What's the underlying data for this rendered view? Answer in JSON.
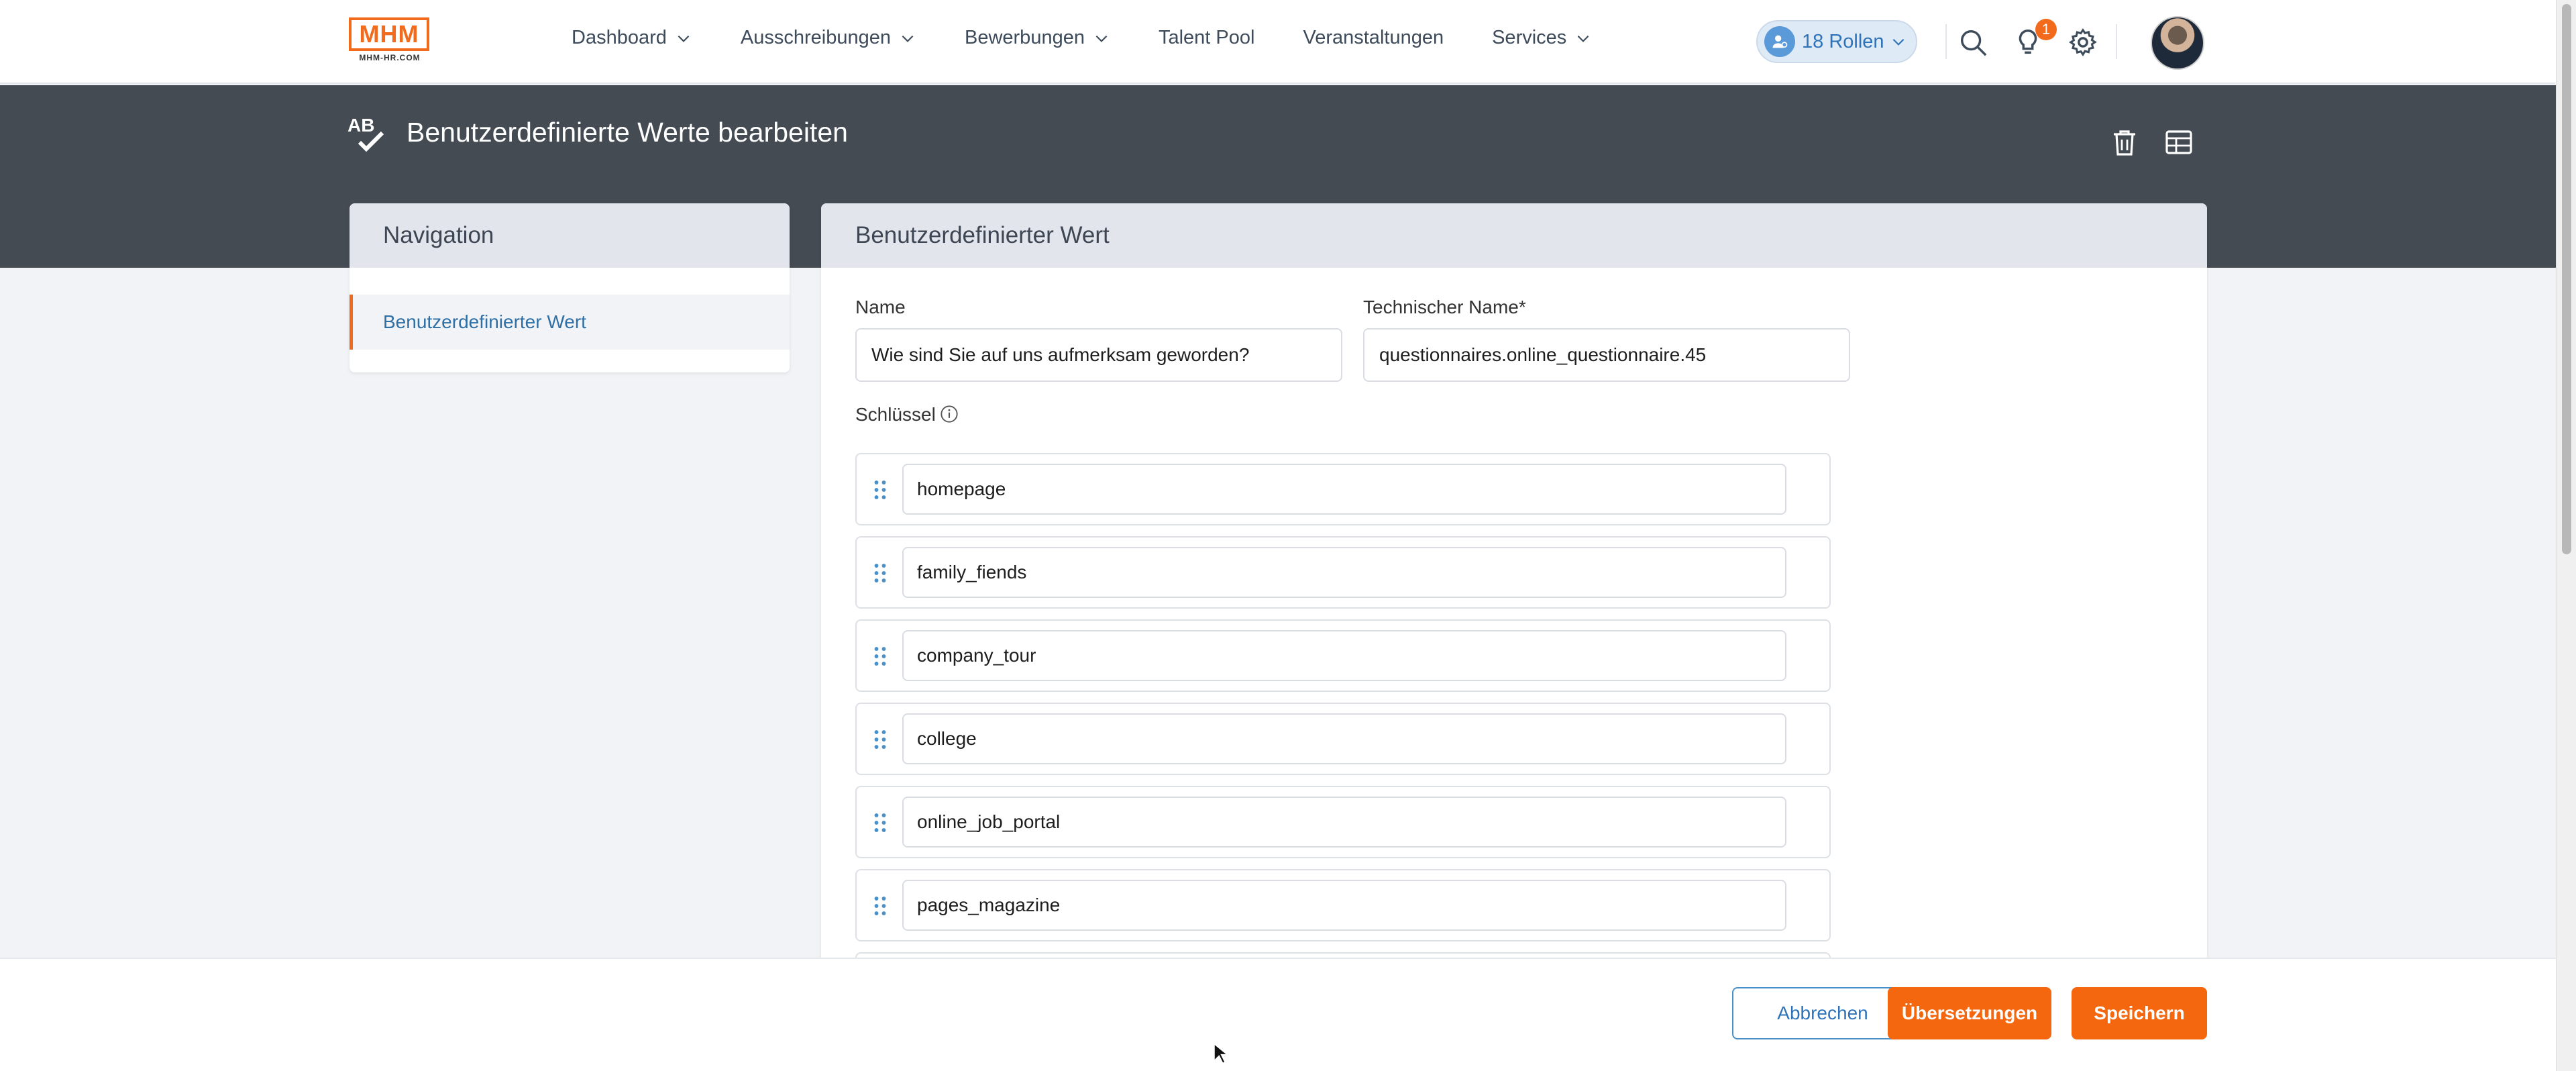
{
  "logo": {
    "mark": "MHM",
    "sub": "MHM-HR.COM"
  },
  "nav": {
    "items": [
      {
        "label": "Dashboard",
        "dropdown": true
      },
      {
        "label": "Ausschreibungen",
        "dropdown": true
      },
      {
        "label": "Bewerbungen",
        "dropdown": true
      },
      {
        "label": "Talent Pool",
        "dropdown": false
      },
      {
        "label": "Veranstaltungen",
        "dropdown": false
      },
      {
        "label": "Services",
        "dropdown": true
      }
    ],
    "roles_label": "18 Rollen",
    "notification_count": "1"
  },
  "header": {
    "title": "Benutzerdefinierte Werte bearbeiten",
    "title_icon": "ab-check-icon",
    "actions": [
      "trash-icon",
      "table-icon"
    ]
  },
  "sidebar": {
    "title": "Navigation",
    "items": [
      {
        "label": "Benutzerdefinierter Wert",
        "active": true
      }
    ]
  },
  "form": {
    "title": "Benutzerdefinierter Wert",
    "name_label": "Name",
    "name_value": "Wie sind Sie auf uns aufmerksam geworden?",
    "tech_label": "Technischer Name*",
    "tech_value": "questionnaires.online_questionnaire.45",
    "keys_label": "Schlüssel",
    "keys": [
      "homepage",
      "family_fiends",
      "company_tour",
      "college",
      "online_job_portal",
      "pages_magazine"
    ]
  },
  "footer": {
    "cancel": "Abbrechen",
    "translations": "Übersetzungen",
    "save": "Speichern"
  },
  "colors": {
    "accent": "#f5670f",
    "header_band": "#444b53",
    "link": "#2e6fa5",
    "outline_button": "#4a90c8"
  }
}
